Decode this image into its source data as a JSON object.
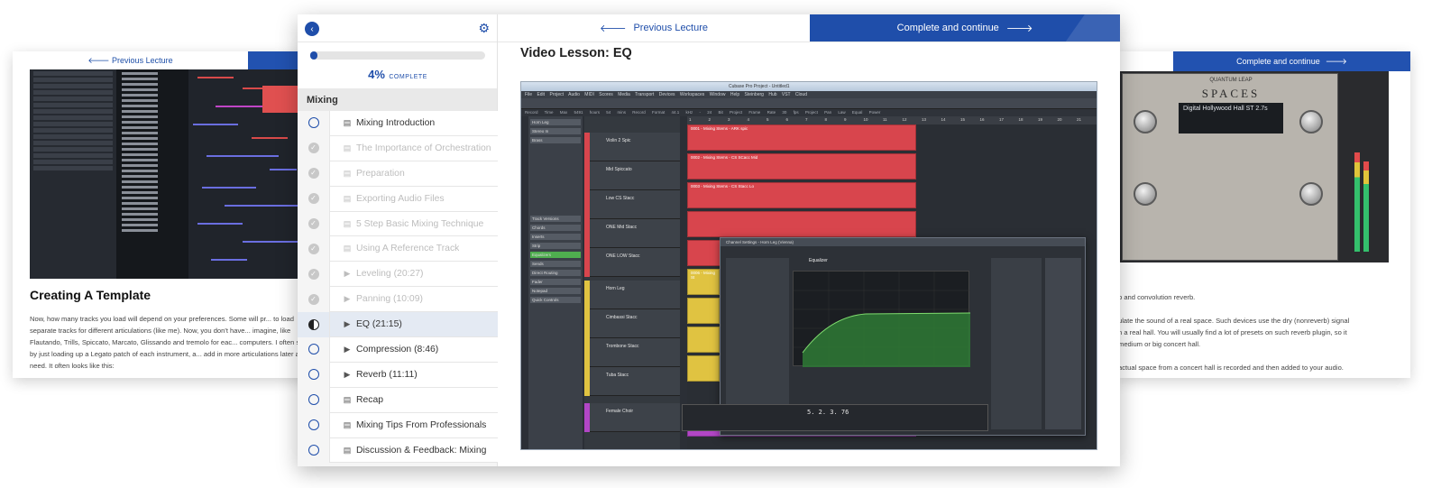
{
  "left_card": {
    "prev_label": "Previous Lecture",
    "heading": "Creating A Template",
    "paragraph": "Now, how many tracks you load will depend on your preferences. Some will pr... to load separate tracks for different articulations (like me). Now, you don't have... imagine, like Flautando, Trills, Spiccato, Marcato, Glissando and tremolo for eac... computers. I often start by just loading up a Legato patch of each instrument, a... add in more articulations later as I need. It often looks like this:"
  },
  "right_card": {
    "cta_label": "Complete and continue",
    "plugin_brand": "QUANTUM LEAP",
    "plugin_name": "SPACES",
    "plugin_preset": "Digital Hollywood Hall ST 2.7s",
    "text_lines": [
      "b and convolution reverb.",
      "ulate the sound of a real space. Such devices use the dry (nonreverb) signal",
      "n a real hall. You will usually find a lot of presets on such reverb plugin, so it",
      "medium or big concert hall.",
      "actual space from a concert hall is recorded and then added to your audio."
    ]
  },
  "sidebar": {
    "progress_percent": 4,
    "progress_pct_text": "4%",
    "progress_label": "COMPLETE",
    "section_title": "Mixing",
    "lessons": [
      {
        "title": "Mixing Introduction",
        "type": "doc",
        "state": "todo"
      },
      {
        "title": "The Importance of Orchestration",
        "type": "doc",
        "state": "done"
      },
      {
        "title": "Preparation",
        "type": "doc",
        "state": "done"
      },
      {
        "title": "Exporting Audio Files",
        "type": "doc",
        "state": "done"
      },
      {
        "title": "5 Step Basic Mixing Technique",
        "type": "doc",
        "state": "done"
      },
      {
        "title": "Using A Reference Track",
        "type": "doc",
        "state": "done"
      },
      {
        "title": "Leveling (20:27)",
        "type": "video",
        "state": "done"
      },
      {
        "title": "Panning (10:09)",
        "type": "video",
        "state": "done"
      },
      {
        "title": "EQ (21:15)",
        "type": "video",
        "state": "current"
      },
      {
        "title": "Compression (8:46)",
        "type": "video",
        "state": "todo"
      },
      {
        "title": "Reverb (11:11)",
        "type": "video",
        "state": "todo"
      },
      {
        "title": "Recap",
        "type": "doc",
        "state": "todo"
      },
      {
        "title": "Mixing Tips From Professionals",
        "type": "doc",
        "state": "todo"
      },
      {
        "title": "Discussion & Feedback: Mixing",
        "type": "doc",
        "state": "todo"
      }
    ]
  },
  "nav": {
    "prev_label": "Previous Lecture",
    "next_label": "Complete and continue"
  },
  "lesson_title": "Video Lesson: EQ",
  "video": {
    "window_title": "Cubase Pro Project - Untitled1",
    "menu": "File Edit Project Audio MIDI Scores Media Transport Devices Workspaces Window Help Steinberg Hub VST Cloud",
    "status": "Record Time Max 5491 hours 54 mins Record Format 44.1 kHz - 24 Bit Project Frame Rate 30 fps Project Pan Law Equal Power",
    "inspector_items": [
      "Horn Leg",
      "Stereo In",
      "Brass",
      "Track Versions",
      "Chords",
      "Inserts",
      "Strip",
      "Equalizers",
      "Sends",
      "Direct Routing",
      "Fader",
      "Notepad",
      "Quick Controls"
    ],
    "tracks": [
      "Violin 2 Spic",
      "Mid Spiccato",
      "Low CS Stacc",
      "ONE Mid Stacc",
      "ONE LOW Stacc",
      "Horn Leg",
      "Cimbassi Stacc",
      "Trombone Stacc",
      "Tuba Stacc",
      "Female Choir"
    ],
    "ruler_marks": [
      "1",
      "2",
      "3",
      "4",
      "5",
      "6",
      "7",
      "8",
      "9",
      "10",
      "11",
      "12",
      "13",
      "14",
      "15",
      "16",
      "17",
      "18",
      "19",
      "20",
      "21"
    ],
    "mixer_title": "Channel Settings - Horn Leg (Vienna)",
    "mixer_channel": "Horn Leg",
    "mixer_tabs": [
      "Inserts",
      "Strip",
      "Channel Strip",
      "Equalizer",
      "Sends",
      "Cue Sends"
    ],
    "timecode": "5. 2. 3. 76"
  },
  "colors": {
    "accent": "#1f4eaa",
    "clip_red": "#d8454d",
    "clip_yellow": "#e0c341",
    "clip_purple": "#b246c6"
  }
}
